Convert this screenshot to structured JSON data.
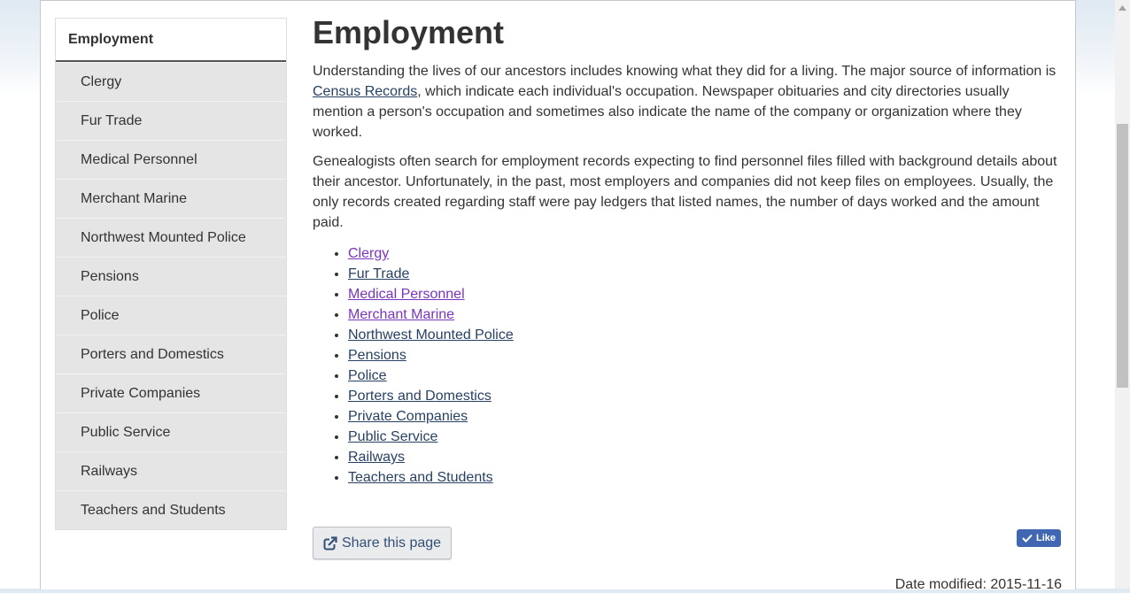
{
  "sidebar": {
    "title": "Employment",
    "items": [
      {
        "label": "Clergy"
      },
      {
        "label": "Fur Trade"
      },
      {
        "label": "Medical Personnel"
      },
      {
        "label": "Merchant Marine"
      },
      {
        "label": "Northwest Mounted Police"
      },
      {
        "label": "Pensions"
      },
      {
        "label": "Police"
      },
      {
        "label": "Porters and Domestics"
      },
      {
        "label": "Private Companies"
      },
      {
        "label": "Public Service"
      },
      {
        "label": "Railways"
      },
      {
        "label": "Teachers and Students"
      }
    ]
  },
  "main": {
    "title": "Employment",
    "para1_before": "Understanding the lives of our ancestors includes knowing what they did for a living. The major source of information is ",
    "para1_link": "Census Records",
    "para1_after": ", which indicate each individual's occupation. Newspaper obituaries and city directories usually mention a person's occupation and sometimes also indicate the name of the company or organization where they worked.",
    "para2": "Genealogists often search for employment records expecting to find personnel files filled with background details about their ancestor. Unfortunately, in the past, most employers and companies did not keep files on employees. Usually, the only records created regarding staff were pay ledgers that listed names, the number of days worked and the amount paid.",
    "links": [
      {
        "label": "Clergy",
        "visited": true
      },
      {
        "label": "Fur Trade",
        "visited": false
      },
      {
        "label": "Medical Personnel",
        "visited": true
      },
      {
        "label": "Merchant Marine",
        "visited": true
      },
      {
        "label": "Northwest Mounted Police",
        "visited": false
      },
      {
        "label": "Pensions",
        "visited": false
      },
      {
        "label": "Police",
        "visited": false
      },
      {
        "label": "Porters and Domestics",
        "visited": false
      },
      {
        "label": "Private Companies",
        "visited": false
      },
      {
        "label": "Public Service",
        "visited": false
      },
      {
        "label": "Railways",
        "visited": false
      },
      {
        "label": "Teachers and Students",
        "visited": false
      }
    ],
    "share_label": "Share this page",
    "like_label": "Like",
    "date_modified": "Date modified: 2015-11-16"
  },
  "colors": {
    "link": "#284162",
    "visited_link": "#7834bc",
    "like_blue": "#4267b2",
    "sidebar_bg": "#e5e5e5"
  },
  "icons": {
    "share": "share-external-icon",
    "like": "checkmark-icon"
  }
}
